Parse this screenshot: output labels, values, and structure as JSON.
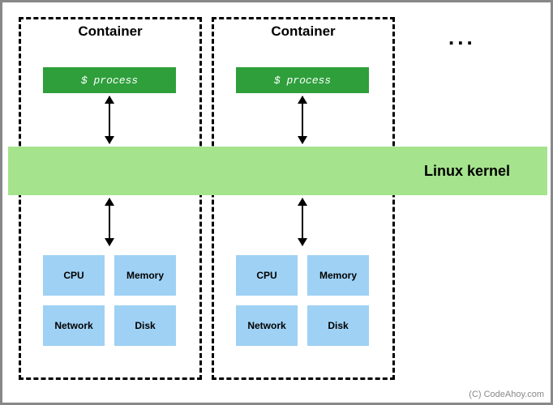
{
  "containers": [
    {
      "title": "Container",
      "process_label": "$ process"
    },
    {
      "title": "Container",
      "process_label": "$ process"
    }
  ],
  "kernel_label": "Linux kernel",
  "resources": [
    {
      "label": "CPU"
    },
    {
      "label": "Memory"
    },
    {
      "label": "Network"
    },
    {
      "label": "Disk"
    }
  ],
  "ellipsis": "...",
  "attribution": "(C) CodeAhoy.com",
  "colors": {
    "process_bg": "#2e9f3b",
    "kernel_bg": "#a5e38d",
    "resource_bg": "#9fd1f4",
    "outer_border": "#888888"
  }
}
